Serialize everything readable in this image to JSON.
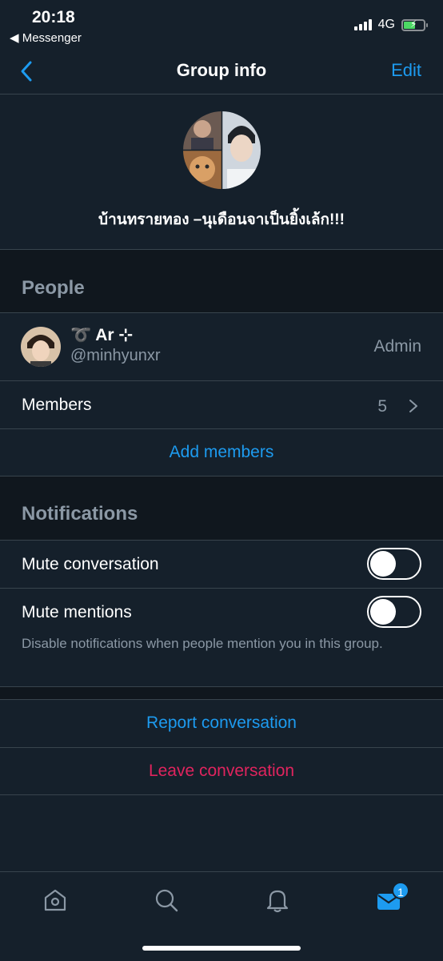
{
  "status_bar": {
    "time": "20:18",
    "back_app": "◀ Messenger",
    "network": "4G"
  },
  "nav": {
    "title": "Group info",
    "edit_label": "Edit"
  },
  "group": {
    "name": "บ้านทรายทอง –นุเดือนจาเป็นยิ้งเล้ก!!!"
  },
  "people": {
    "section_title": "People",
    "admin": {
      "name": "➰ Ar ⊹",
      "handle": "@minhyunxr",
      "role": "Admin"
    },
    "members_label": "Members",
    "members_count": "5",
    "add_members_label": "Add members"
  },
  "notifications": {
    "section_title": "Notifications",
    "mute_conversation_label": "Mute conversation",
    "mute_conversation_on": false,
    "mute_mentions_label": "Mute mentions",
    "mute_mentions_on": false,
    "mute_mentions_hint": "Disable notifications when people mention you in this group."
  },
  "actions": {
    "report_label": "Report conversation",
    "leave_label": "Leave conversation"
  },
  "tab_bar": {
    "tabs": [
      "home-icon",
      "search-icon",
      "bell-icon",
      "mail-icon"
    ],
    "messages_badge": "1"
  },
  "colors": {
    "background": "#15202b",
    "accent": "#1d9bf0",
    "danger": "#e0245e",
    "muted": "#8b98a5",
    "divider": "#38444d"
  }
}
